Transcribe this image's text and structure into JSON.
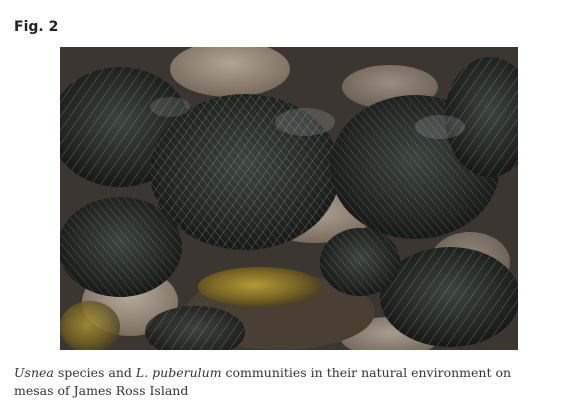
{
  "figure": {
    "label": "Fig. 2",
    "caption": {
      "taxon_1": "Usnea",
      "text_1": " species and ",
      "taxon_2": "L. puberulum",
      "text_2": " communities in their natural environment on mesas of James Ross Island"
    }
  },
  "colors": {
    "lichen_dark": "#2b2f2c",
    "lichen_light": "#c9d0cd",
    "moss": "#8a7a2a",
    "rock": "#b9a896",
    "soil": "#4a3f33"
  }
}
